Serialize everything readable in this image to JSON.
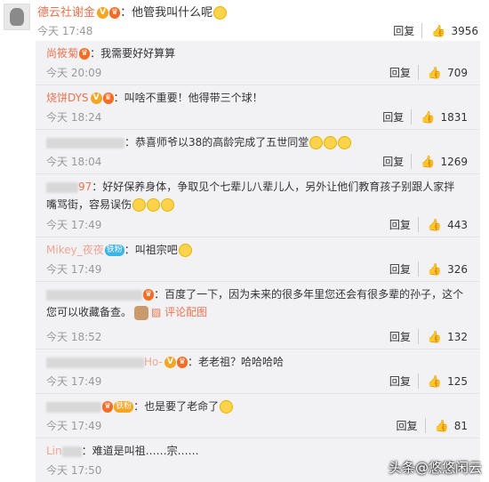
{
  "main_comment": {
    "username": "德云社谢金",
    "text": "：他管我叫什么呢",
    "time": "今天 17:48",
    "reply_label": "回复",
    "likes": "3956"
  },
  "sub_comments": [
    {
      "username": "尚筱菊",
      "badges": [
        "v"
      ],
      "text": "：我需要好好算算",
      "time": "今天 20:09",
      "reply_label": "回复",
      "likes": "709"
    },
    {
      "username": "烧饼DYS",
      "badges": [
        "v",
        "vip"
      ],
      "text": "：叫啥不重要！他得带三个球！",
      "time": "今天 18:24",
      "reply_label": "回复",
      "likes": "1831"
    },
    {
      "username": "",
      "text": "：恭喜师爷以38的高龄完成了五世同堂",
      "time": "今天 18:04",
      "reply_label": "回复",
      "likes": "1269"
    },
    {
      "username": "97",
      "text": "：好好保养身体，争取见个七辈儿八辈儿人，另外让他们教育孩子别跟人家拌嘴骂街，容易误伤",
      "time": "今天 17:49",
      "reply_label": "回复",
      "likes": "443"
    },
    {
      "username": "Mikey_夜夜",
      "fan_badge": "铁粉",
      "text": "：叫祖宗吧",
      "time": "今天 17:49",
      "reply_label": "回复",
      "likes": "326"
    },
    {
      "username": "",
      "text": "：百度了一下，因为未来的很多年里您还会有很多辈的孙子，这个您可以收藏备查。",
      "pic_label": "评论配图",
      "time": "今天 18:52",
      "reply_label": "回复",
      "likes": "132"
    },
    {
      "username": "Ho-",
      "text": "：老老祖？哈哈哈哈",
      "time": "今天 17:49",
      "reply_label": "回复",
      "likes": "125"
    },
    {
      "username": "",
      "fan_badge": "铁粉",
      "text": "：也是要了老命了",
      "time": "今天 17:49",
      "reply_label": "回复",
      "likes": "81"
    },
    {
      "username": "Lin",
      "text": "：难道是叫祖……宗……",
      "time": "今天 17:50",
      "reply_label": "",
      "likes": ""
    }
  ],
  "watermark": "头条@悠悠闲云",
  "colors": {
    "username": "#eb7350",
    "panel_bg": "#f2f2f5",
    "time": "#999999"
  }
}
